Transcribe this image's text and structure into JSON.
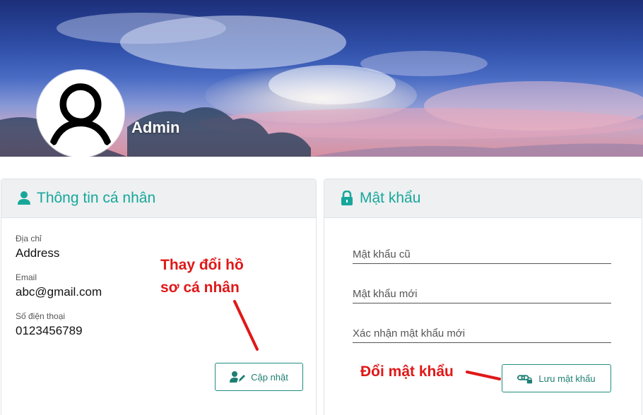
{
  "banner": {
    "username": "Admin"
  },
  "profile_card": {
    "title": "Thông tin cá nhân",
    "fields": [
      {
        "label": "Địa chỉ",
        "value": "Address"
      },
      {
        "label": "Email",
        "value": "abc@gmail.com"
      },
      {
        "label": "Số điện thoại",
        "value": "0123456789"
      }
    ],
    "update_button": "Cập nhật",
    "annotation_line1": "Thay đổi hồ",
    "annotation_line2": "sơ cá nhân"
  },
  "password_card": {
    "title": "Mật khẩu",
    "old_password_placeholder": "Mật khẩu cũ",
    "new_password_placeholder": "Mật khẩu mới",
    "confirm_password_placeholder": "Xác nhận mật khẩu mới",
    "save_button": "Lưu mật khẩu",
    "annotation": "Đổi mật khẩu"
  },
  "colors": {
    "accent": "#17a79a",
    "annotation": "#e01818"
  }
}
